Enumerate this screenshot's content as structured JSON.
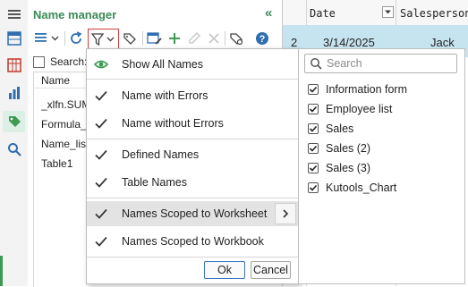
{
  "panel": {
    "title": "Name manager",
    "search_label": "Search:",
    "list_header": "Name",
    "names": [
      "_xlfn.SUM",
      "Formula_a",
      "Name_list",
      "Table1"
    ]
  },
  "sheet": {
    "col_headers": [
      "Date",
      "Salesperson"
    ],
    "row_number": "2",
    "row_values": [
      "3/14/2025",
      "Jack"
    ]
  },
  "filter_menu": {
    "show_all": "Show All Names",
    "with_errors": "Name with Errors",
    "without_errors": "Name without Errors",
    "defined": "Defined Names",
    "table": "Table Names",
    "scoped_worksheet": "Names Scoped to Worksheet",
    "scoped_workbook": "Names Scoped to Workbook",
    "ok": "Ok",
    "cancel": "Cancel"
  },
  "filter_list": {
    "search_placeholder": "Search",
    "items": [
      "Information form",
      "Employee list",
      "Sales",
      "Sales (2)",
      "Sales (3)",
      "Kutools_Chart"
    ]
  },
  "colors": {
    "accent_green": "#3b8a57",
    "filter_highlight": "#d03a3a",
    "row_highlight": "#c6e4ef"
  }
}
